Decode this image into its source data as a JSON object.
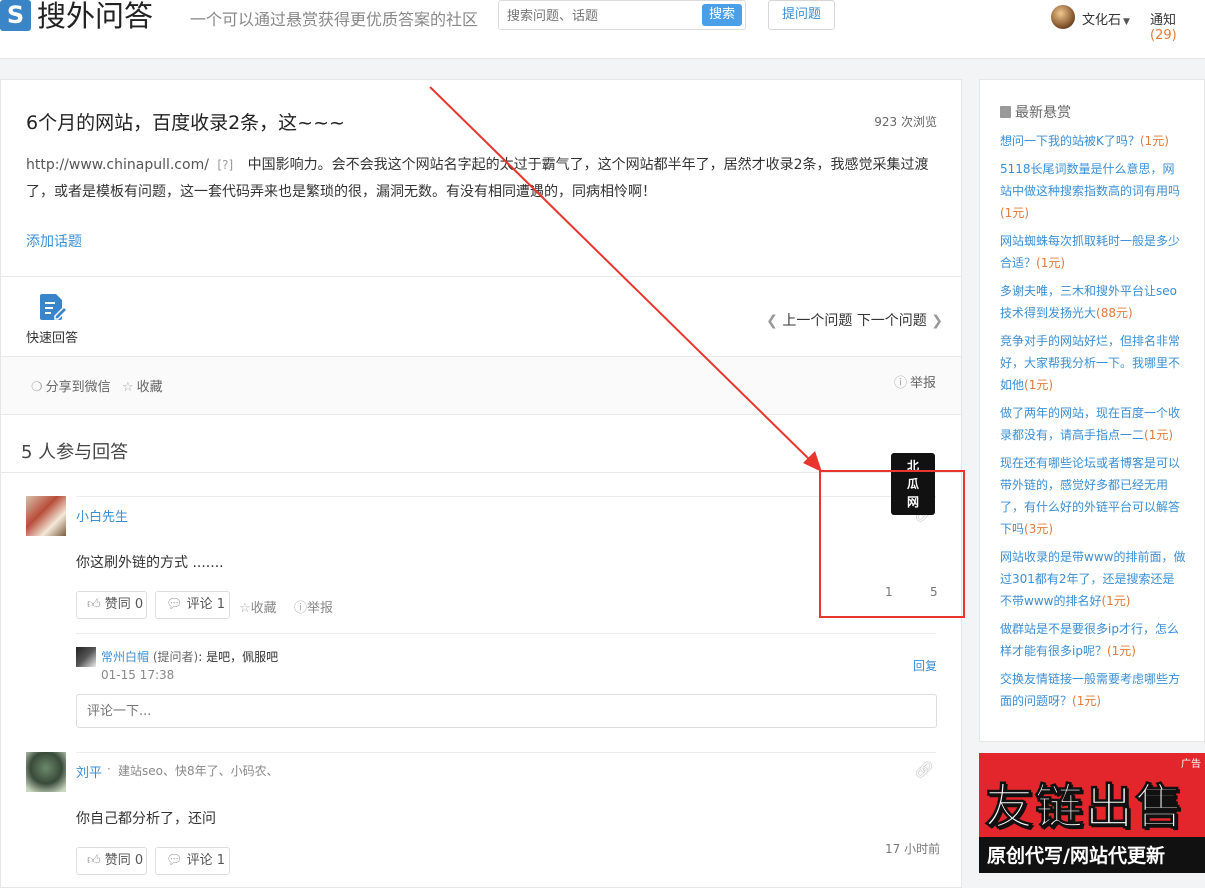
{
  "header": {
    "logo_letter": "S",
    "logo_text": "搜外问答",
    "slogan": "一个可以通过悬赏获得更优质答案的社区",
    "search_placeholder": "搜索问题、话题",
    "search_button": "搜索",
    "ask_button": "提问题",
    "user_name": "文化石",
    "notify_label": "通知",
    "notify_count": "(29)"
  },
  "question": {
    "title": "6个月的网站，百度收录2条，这~~~",
    "views": "923 次浏览",
    "url": "http://www.chinapull.com/",
    "url_tip": "[?]",
    "body": "中国影响力。会不会我这个网站名字起的太过于霸气了，这个网站都半年了，居然才收录2条，我感觉采集过渡了，或者是模板有问题，这一套代码弄来也是繁琐的很，漏洞无数。有没有相同遭遇的，同病相怜啊！",
    "add_topic": "添加话题",
    "quick_answer": "快速回答",
    "prev": "上一个问题",
    "next": "下一个问题",
    "share_wechat": "分享到微信",
    "favorite": "收藏",
    "report": "举报"
  },
  "answers_header": "5 人参与回答",
  "answers": [
    {
      "name": "小白先生",
      "text": "你这刷外链的方式 .......",
      "like": "赞同 0",
      "comment": "评论 1",
      "favorite": "收藏",
      "report": "举报",
      "time": "1",
      "time_tail": "5",
      "reply": {
        "name": "常州白帽",
        "role": "(提问者)",
        "text": ": 是吧，佩服吧",
        "time": "01-15 17:38",
        "reply_link": "回复"
      },
      "comment_placeholder": "评论一下..."
    },
    {
      "name": "刘平",
      "bio": "建站seo、快8年了、小码农、",
      "text": "你自己都分析了，还问",
      "like": "赞同 0",
      "comment": "评论 1",
      "time": "17 小时前"
    }
  ],
  "tooltip": {
    "l1": "北",
    "l2": "瓜",
    "l3": "网"
  },
  "sidebar": {
    "title": "最新悬赏",
    "items": [
      {
        "text": "想问一下我的站被K了吗？",
        "reward": "(1元)"
      },
      {
        "text": "5118长尾词数量是什么意思，网站中做这种搜索指数高的词有用吗",
        "reward": "(1元)"
      },
      {
        "text": "网站蜘蛛每次抓取耗时一般是多少合适？",
        "reward": "(1元)"
      },
      {
        "text": "多谢夫唯，三木和搜外平台让seo技术得到发扬光大",
        "reward": "(88元)"
      },
      {
        "text": "竞争对手的网站好烂，但排名非常好，大家帮我分析一下。我哪里不如他",
        "reward": "(1元)"
      },
      {
        "text": "做了两年的网站，现在百度一个收录都没有，请高手指点一二",
        "reward": "(1元)"
      },
      {
        "text": "现在还有哪些论坛或者博客是可以带外链的，感觉好多都已经无用了，有什么好的外链平台可以解答下吗",
        "reward": "(3元)"
      },
      {
        "text": "网站收录的是带www的排前面，做过301都有2年了，还是搜索还是不带www的排名好",
        "reward": "(1元)"
      },
      {
        "text": "做群站是不是要很多ip才行，怎么样才能有很多ip呢？",
        "reward": "(1元)"
      },
      {
        "text": "交换友情链接一般需要考虑哪些方面的问题呀？",
        "reward": "(1元)"
      }
    ]
  },
  "ad": {
    "tag": "广告",
    "main": "友链出售",
    "sub": "原创代写/网站代更新"
  }
}
